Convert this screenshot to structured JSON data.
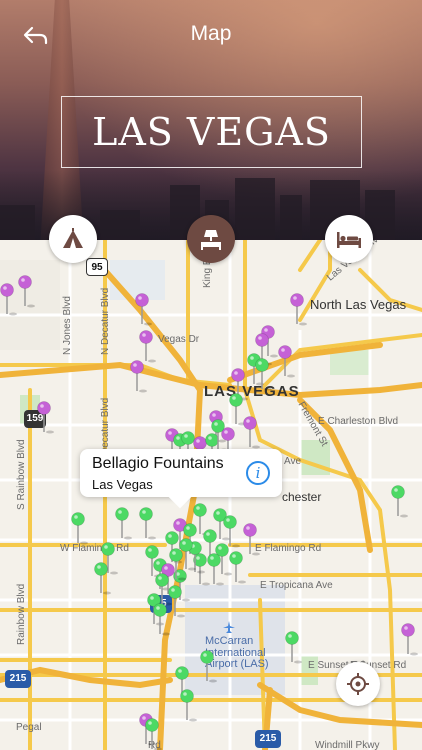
{
  "header": {
    "title": "Map",
    "city": "LAS VEGAS"
  },
  "categories": [
    {
      "name": "attractions",
      "icon": "tent-icon",
      "active": false
    },
    {
      "name": "hotels",
      "icon": "hotel-bed-icon",
      "active": true
    },
    {
      "name": "stays",
      "icon": "bed-icon",
      "active": false
    }
  ],
  "callout": {
    "title": "Bellagio Fountains",
    "subtitle": "Las Vegas",
    "info_icon": "info-icon",
    "info_glyph": "i"
  },
  "map_labels": {
    "city_center": "LAS VEGAS",
    "north": "North Las Vegas",
    "charleston": "E Charleston Blvd",
    "vegas_dr": "Vegas Dr",
    "jones": "N Jones Blvd",
    "decatur_n": "N Decatur Blvd",
    "decatur": "Decatur Blvd",
    "rainbow_s": "S Rainbow Blvd",
    "rainbow": "Rainbow Blvd",
    "king": "King Blvd",
    "fremont": "Fremont St",
    "w_flamingo": "W Flamingo Rd",
    "e_flamingo": "E Flamingo Rd",
    "tropicana": "E Tropicana Ave",
    "sunset": "E Sunset Rd",
    "sunset_rd": "E Sunset Rd",
    "windmill": "Windmill Pkwy",
    "mccarran_1": "McCarran",
    "mccarran_2": "International",
    "mccarran_3": "Airport (LAS)",
    "lake_mead": "Las Vegas Blvd",
    "chester": "chester",
    "ave_frag": "Ave",
    "pegal": "Pegal",
    "rd_frag": "Rd"
  },
  "shields": {
    "us95": "95",
    "i15a": "15",
    "i215a": "215",
    "i215b": "215",
    "nv159": "159",
    "i515": "15"
  },
  "colors": {
    "pin_green": "#4cd964",
    "pin_purple": "#c561d6",
    "accent_brown": "#6e4a42",
    "info_blue": "#2b8be8",
    "road_yellow": "#f5c94b"
  }
}
